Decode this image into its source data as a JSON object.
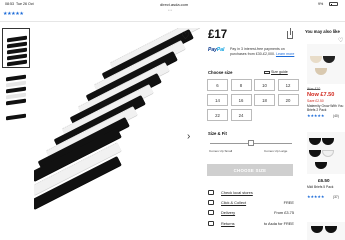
{
  "status_bar": {
    "time": "08:53",
    "date": "Tue 26 Oct",
    "url": "direct.asda.com",
    "battery": "9%"
  },
  "rating": {
    "stars": "★★★★★",
    "value": 4.5
  },
  "product": {
    "price": "£17",
    "paypal": {
      "logo_pay": "Pay",
      "logo_pal": "Pal",
      "text": "Pay in 3 interest-free payments on purchases from £30-£2,000.",
      "link": "Learn more"
    },
    "choose_size_label": "Choose size",
    "size_guide_label": "Size guide",
    "sizes": [
      "6",
      "8",
      "10",
      "12",
      "14",
      "16",
      "18",
      "20",
      "22",
      "24"
    ],
    "size_fit_label": "Size & Fit",
    "fit_small": "Comes Up Small",
    "fit_large": "Comes Up Large",
    "fit_level": 0.5,
    "choose_size_button": "CHOOSE SIZE",
    "info_rows": [
      {
        "label": "Check local stores",
        "value": "",
        "icon": "store-icon"
      },
      {
        "label": "Click & Collect",
        "value": "FREE",
        "icon": "collect-icon"
      },
      {
        "label": "Delivery",
        "value": "From £3.75",
        "icon": "delivery-icon"
      },
      {
        "label": "Returns",
        "value": "to Asda for FREE",
        "icon": "returns-icon"
      }
    ]
  },
  "you_may_also_like": {
    "title": "You may also like",
    "items": [
      {
        "was": "Was £10",
        "now": "Now £7.50",
        "save": "Save £2.50",
        "name": "Maternity Grow With You Briefs 2 Pack",
        "stars": "★★★★★",
        "count": "(40)"
      },
      {
        "price": "£6.50",
        "name": "Midi Briefs 5 Pack",
        "stars": "★★★★★",
        "count": "(37)"
      }
    ]
  },
  "colors": {
    "accent": "#1a6ad8",
    "sale": "#d1271d",
    "button_disabled": "#cfcfcf",
    "paypal_dark": "#003087",
    "paypal_light": "#009cde"
  }
}
